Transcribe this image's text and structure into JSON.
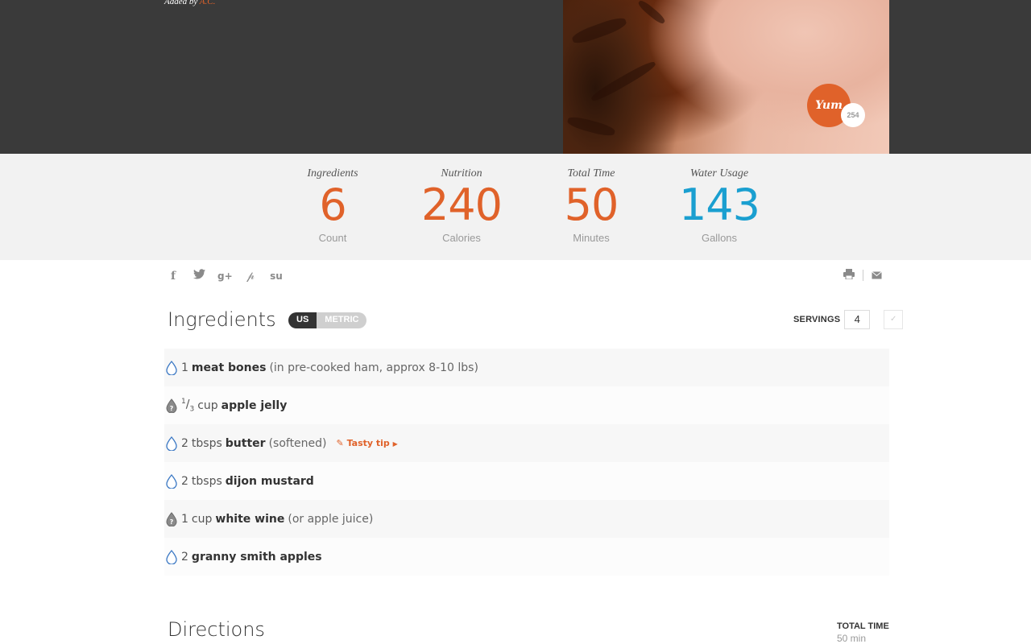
{
  "hero": {
    "added_by_prefix": "Added by",
    "author": "A.C.",
    "yum_label": "Yum",
    "yum_count": "254"
  },
  "stats": [
    {
      "label": "Ingredients",
      "value": "6",
      "unit": "Count",
      "color": "#e0622a"
    },
    {
      "label": "Nutrition",
      "value": "240",
      "unit": "Calories",
      "color": "#e0622a"
    },
    {
      "label": "Total Time",
      "value": "50",
      "unit": "Minutes",
      "color": "#e0622a"
    },
    {
      "label": "Water Usage",
      "value": "143",
      "unit": "Gallons",
      "color": "#1a9fd0"
    }
  ],
  "social_icons": [
    "facebook-icon",
    "twitter-icon",
    "google-plus-icon",
    "pinterest-icon",
    "stumbleupon-icon"
  ],
  "tool_icons": [
    "print-icon",
    "email-icon"
  ],
  "ingredients": {
    "title": "Ingredients",
    "unit_toggle": {
      "us": "US",
      "metric": "METRIC",
      "selected": "US"
    },
    "servings_label": "SERVINGS",
    "servings_value": "4",
    "items": [
      {
        "icon": "water-drop-icon",
        "qty": "1",
        "unit": "",
        "name": "meat bones",
        "note": "(in pre-cooked ham, approx 8-10 lbs)"
      },
      {
        "icon": "unknown-drop-icon",
        "qty_num": "1",
        "qty_den": "3",
        "unit": "cup",
        "name": "apple jelly",
        "note": ""
      },
      {
        "icon": "water-drop-icon",
        "qty": "2",
        "unit": "tbsps",
        "name": "butter",
        "note": "(softened)",
        "tip": "Tasty tip"
      },
      {
        "icon": "water-drop-icon",
        "qty": "2",
        "unit": "tbsps",
        "name": "dijon mustard",
        "note": ""
      },
      {
        "icon": "unknown-drop-icon",
        "qty": "1",
        "unit": "cup",
        "name": "white wine",
        "note": "(or apple juice)"
      },
      {
        "icon": "water-drop-icon",
        "qty": "2",
        "unit": "",
        "name": "granny smith apples",
        "note": ""
      }
    ]
  },
  "directions": {
    "title": "Directions",
    "total_time_label": "TOTAL TIME",
    "total_time_value": "50 min"
  },
  "colors": {
    "accent": "#e0622a",
    "water": "#1a9fd0",
    "hero_bg": "#3a3a3a"
  }
}
